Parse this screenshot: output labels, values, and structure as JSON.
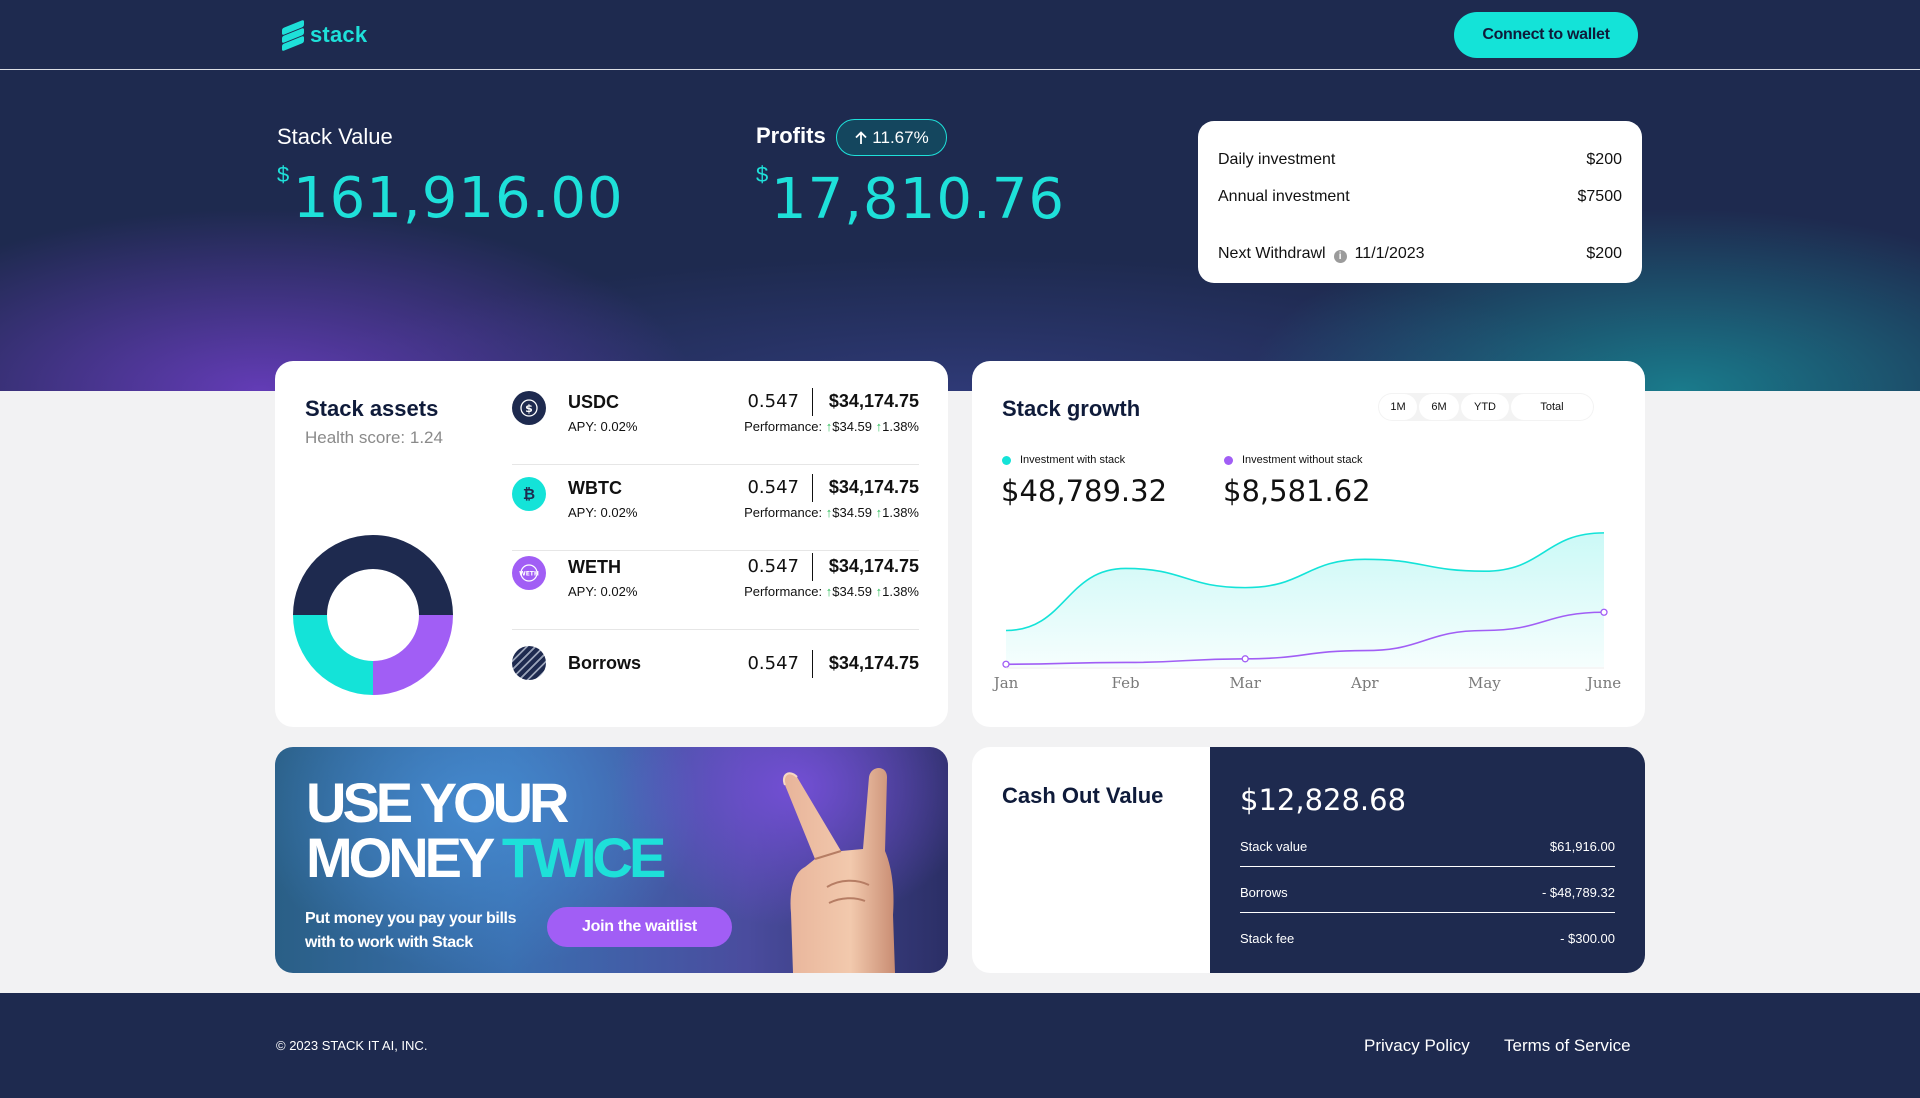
{
  "header": {
    "logo_text": "stack",
    "connect_label": "Connect to wallet"
  },
  "summary": {
    "stack_value_label": "Stack Value",
    "stack_value_currency": "$",
    "stack_value": "161,916.00",
    "profits_label": "Profits",
    "profits_change": "11.67%",
    "profits_currency": "$",
    "profits_value": "17,810.76"
  },
  "investment": {
    "daily_label": "Daily investment",
    "daily_value": "$200",
    "annual_label": "Annual investment",
    "annual_value": "$7500",
    "withdrawal_label": "Next Withdrawl",
    "withdrawal_date": "11/1/2023",
    "withdrawal_value": "$200"
  },
  "assets": {
    "title": "Stack assets",
    "health_score": "Health score: 1.24",
    "allocation": [
      {
        "name": "dark",
        "fraction": 0.5,
        "color": "#1e2a4f"
      },
      {
        "name": "purple",
        "fraction": 0.25,
        "color": "#a15ef5"
      },
      {
        "name": "teal",
        "fraction": 0.25,
        "color": "#14e3d8"
      }
    ],
    "items": [
      {
        "name": "USDC",
        "apy": "APY: 0.02%",
        "qty": "0.547",
        "value": "$34,174.75",
        "perf_label": "Performance:",
        "perf_amount": "$34.59",
        "perf_pct": "1.38%",
        "icon": "usdc-icon",
        "color": "#1e2a4f"
      },
      {
        "name": "WBTC",
        "apy": "APY: 0.02%",
        "qty": "0.547",
        "value": "$34,174.75",
        "perf_label": "Performance:",
        "perf_amount": "$34.59",
        "perf_pct": "1.38%",
        "icon": "bitcoin-icon",
        "color": "#14e3d8"
      },
      {
        "name": "WETH",
        "apy": "APY: 0.02%",
        "qty": "0.547",
        "value": "$34,174.75",
        "perf_label": "Performance:",
        "perf_amount": "$34.59",
        "perf_pct": "1.38%",
        "icon": "weth-icon",
        "color": "#a15ef5"
      },
      {
        "name": "Borrows",
        "qty": "0.547",
        "value": "$34,174.75",
        "icon": "borrows-icon",
        "color": "#1e2a4f"
      }
    ]
  },
  "growth": {
    "title": "Stack growth",
    "ranges": [
      "1M",
      "6M",
      "YTD",
      "Total"
    ],
    "with_stack_label": "Investment with stack",
    "with_stack_value": "$48,789.32",
    "without_stack_label": "Investment without stack",
    "without_stack_value": "$8,581.62"
  },
  "chart_data": {
    "type": "area",
    "categories": [
      "Jan",
      "Feb",
      "Mar",
      "Apr",
      "May",
      "June"
    ],
    "series": [
      {
        "name": "Investment with stack",
        "color": "#14e3d8",
        "values": [
          40,
          108,
          87,
          118,
          105,
          147
        ]
      },
      {
        "name": "Investment without stack",
        "color": "#a15ef5",
        "values": [
          3,
          5,
          9,
          18,
          40,
          60
        ]
      }
    ],
    "ylim": [
      0,
      160
    ],
    "grid": false,
    "legend": "top-left"
  },
  "promo": {
    "line1": "USE YOUR",
    "line2a": "MONEY",
    "line2b": "TWICE",
    "subtitle": "Put money you pay your bills with to work with Stack",
    "cta": "Join the waitlist"
  },
  "cashout": {
    "title": "Cash Out Value",
    "total": "$12,828.68",
    "rows": [
      {
        "label": "Stack value",
        "value": "$61,916.00"
      },
      {
        "label": "Borrows",
        "value": "- $48,789.32"
      },
      {
        "label": "Stack fee",
        "value": "- $300.00"
      }
    ]
  },
  "footer": {
    "copyright": "© 2023 STACK IT AI, INC.",
    "privacy": "Privacy Policy",
    "terms": "Terms of Service"
  }
}
